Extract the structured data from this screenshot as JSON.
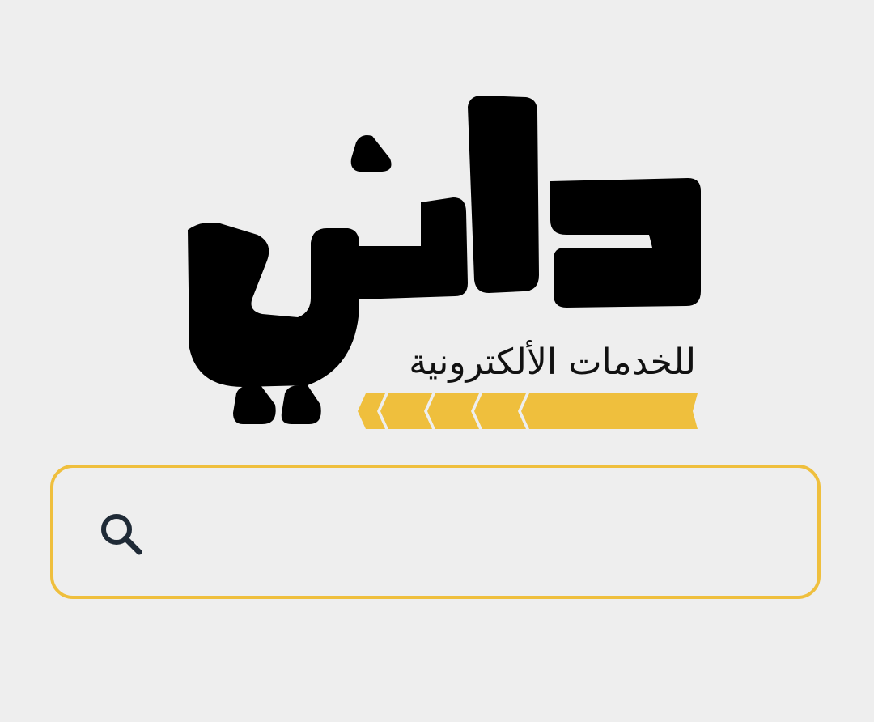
{
  "logo": {
    "wordmark": "دلني",
    "tagline": "للخدمات الألكترونية"
  },
  "search": {
    "placeholder": "",
    "value": "",
    "icon": "search-icon"
  },
  "colors": {
    "background": "#eeeeee",
    "accent": "#efbf3d",
    "logo_black": "#000000",
    "icon": "#1f2a36"
  }
}
